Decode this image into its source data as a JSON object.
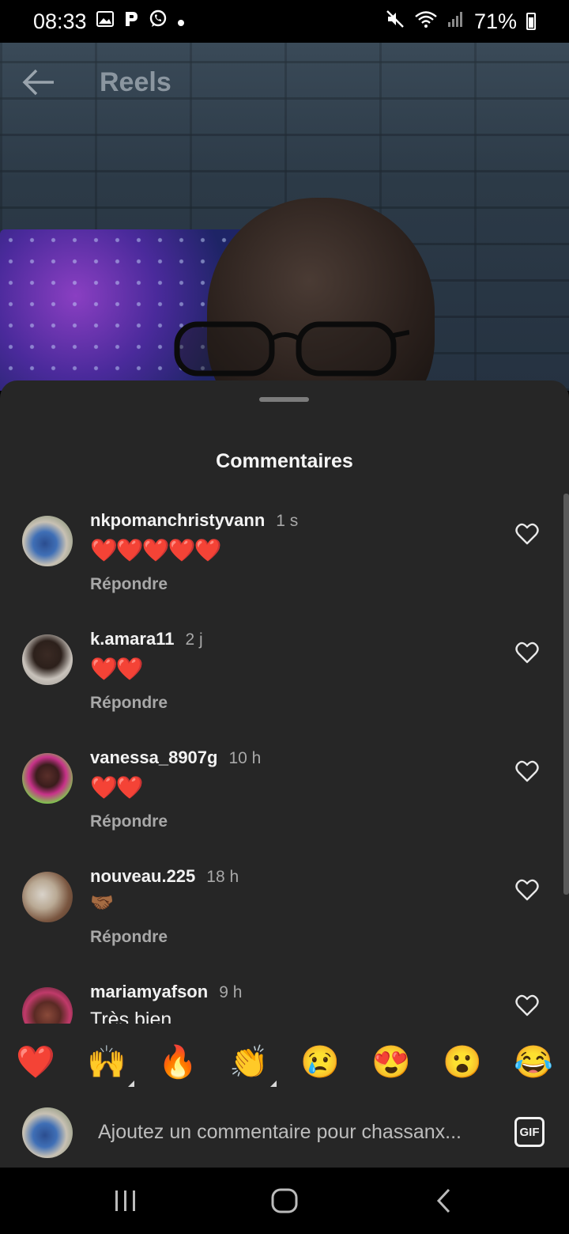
{
  "status_bar": {
    "time": "08:33",
    "battery": "71%",
    "left_icons": [
      "gallery-icon",
      "p-icon",
      "whatsapp-icon",
      "dot-icon"
    ],
    "right_icons": [
      "mute-icon",
      "wifi-icon",
      "signal-icon",
      "battery-icon"
    ]
  },
  "header": {
    "title": "Reels"
  },
  "sheet": {
    "title": "Commentaires"
  },
  "comments": [
    {
      "username": "nkpomanchristyvann",
      "time": "1 s",
      "text": "❤️❤️❤️❤️❤️",
      "reply": "Répondre"
    },
    {
      "username": "k.amara11",
      "time": "2 j",
      "text": "❤️❤️",
      "reply": "Répondre"
    },
    {
      "username": "vanessa_8907g",
      "time": "10 h",
      "text": "❤️❤️",
      "reply": "Répondre"
    },
    {
      "username": "nouveau.225",
      "time": "18 h",
      "text": "🤝🏾",
      "reply": "Répondre"
    },
    {
      "username": "mariamyafson",
      "time": "9 h",
      "text": "Très bien",
      "reply": ""
    }
  ],
  "emoji_bar": [
    "❤️",
    "🙌",
    "🔥",
    "👏",
    "😢",
    "😍",
    "😮",
    "😂"
  ],
  "input": {
    "placeholder": "Ajoutez un commentaire pour chassanx...",
    "gif_label": "GIF"
  },
  "colors": {
    "sheet_bg": "#262626",
    "secondary_text": "#a8a8a8",
    "heart_red": "#ef1f2b"
  }
}
